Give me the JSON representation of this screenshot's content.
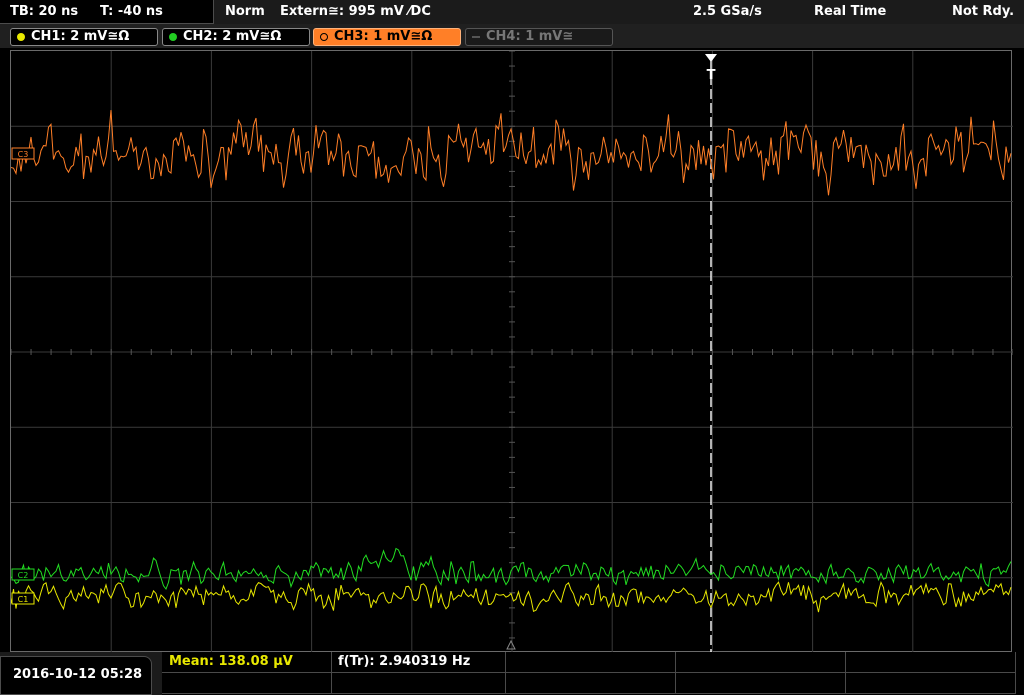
{
  "header": {
    "timebase": "TB: 20 ns",
    "trigger_time": "T: -40 ns",
    "trigger_mode": "Norm",
    "trigger_source": "Extern≅: 995 mV ⁄DC",
    "sample_rate": "2.5 GSa/s",
    "acq_mode": "Real Time",
    "status": "Not Rdy."
  },
  "channels": [
    {
      "label": "CH1: 2 mV≅Ω",
      "color": "#e8e800",
      "state": "on"
    },
    {
      "label": "CH2: 2 mV≅Ω",
      "color": "#22cc22",
      "state": "on"
    },
    {
      "label": "CH3: 1 mV≅Ω",
      "color": "#ff7f27",
      "state": "selected"
    },
    {
      "label": "CH4: 1 mV≅",
      "color": "#777777",
      "state": "off"
    }
  ],
  "markers": {
    "ch1": "C1",
    "ch2": "C2",
    "ch3": "C3",
    "trigger": "T"
  },
  "footer": {
    "datetime": "2016-10-12 05:28",
    "measurement_mean": "Mean: 138.08 µV",
    "measurement_freq": "f(Tr): 2.940319 Hz"
  },
  "colors": {
    "ch1": "#e8e800",
    "ch2": "#22dd22",
    "ch3": "#ff7f27",
    "grid": "#3a3a3a"
  }
}
